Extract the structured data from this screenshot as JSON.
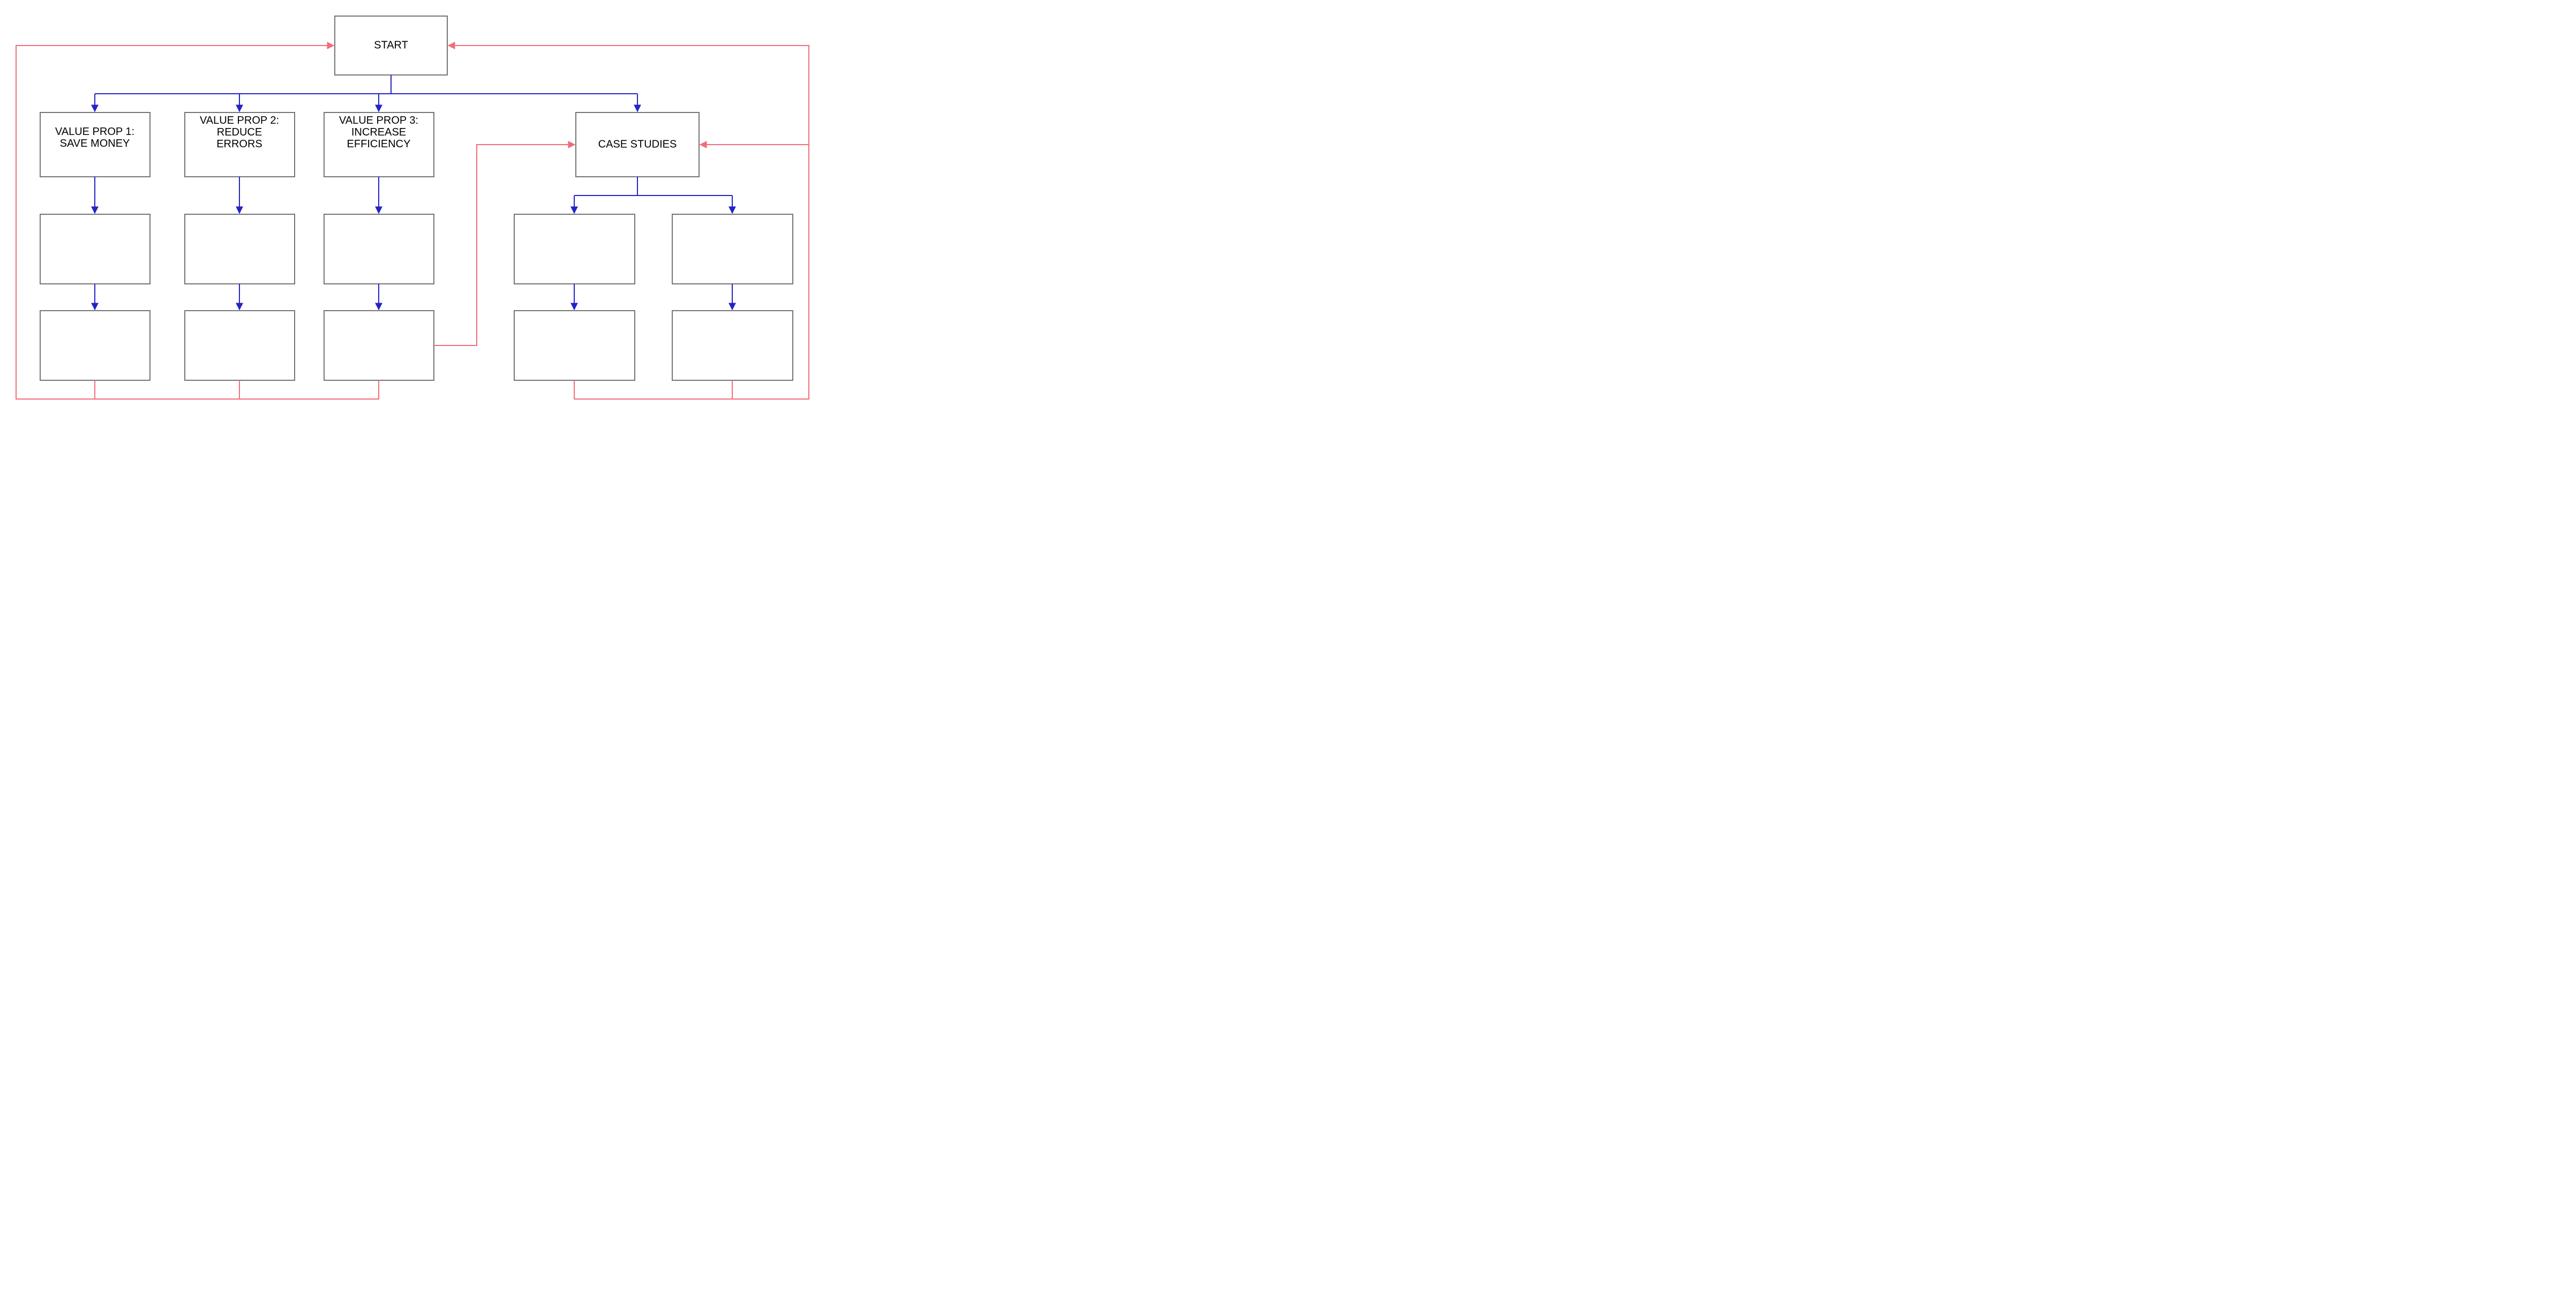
{
  "nodes": {
    "start": "START",
    "vp1": "VALUE PROP 1:\nSAVE MONEY",
    "vp2": "VALUE PROP 2:\nREDUCE\nERRORS",
    "vp3": "VALUE PROP 3:\nINCREASE\nEFFICIENCY",
    "cs": "CASE STUDIES",
    "vp1b": "",
    "vp1c": "",
    "vp2b": "",
    "vp2c": "",
    "vp3b": "",
    "vp3c": "",
    "csA1": "",
    "csA2": "",
    "csB1": "",
    "csB2": ""
  },
  "colors": {
    "blue": "#2323c8",
    "pink": "#f26d78",
    "box": "#757575"
  }
}
